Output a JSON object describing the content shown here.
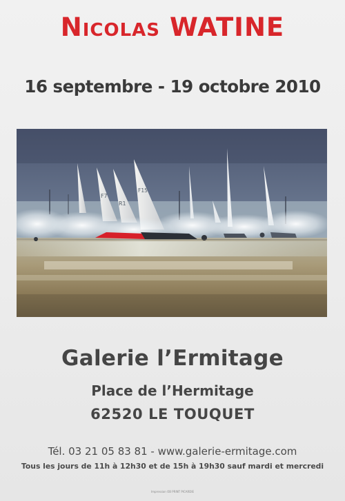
{
  "poster": {
    "artist_first": "Nicolas",
    "artist_last": "WATINE",
    "dates": "16 septembre - 19 octobre 2010",
    "gallery_name": "Galerie l’Ermitage",
    "address_line1": "Place de l’Hermitage",
    "address_line2": "62520 LE TOUQUET",
    "contact": "Tél. 03 21 05 83 81 - www.galerie-ermitage.com",
    "hours": "Tous les jours de 11h à 12h30 et de 15h à 19h30 sauf mardi et mercredi",
    "printer": "Impression OB PRINT PICARDIE"
  },
  "painting": {
    "sail_labels": [
      "F7",
      "R1",
      "F15"
    ]
  },
  "colors": {
    "title_red": "#d8262b",
    "text_dark": "#454545",
    "background": "#ededed"
  }
}
